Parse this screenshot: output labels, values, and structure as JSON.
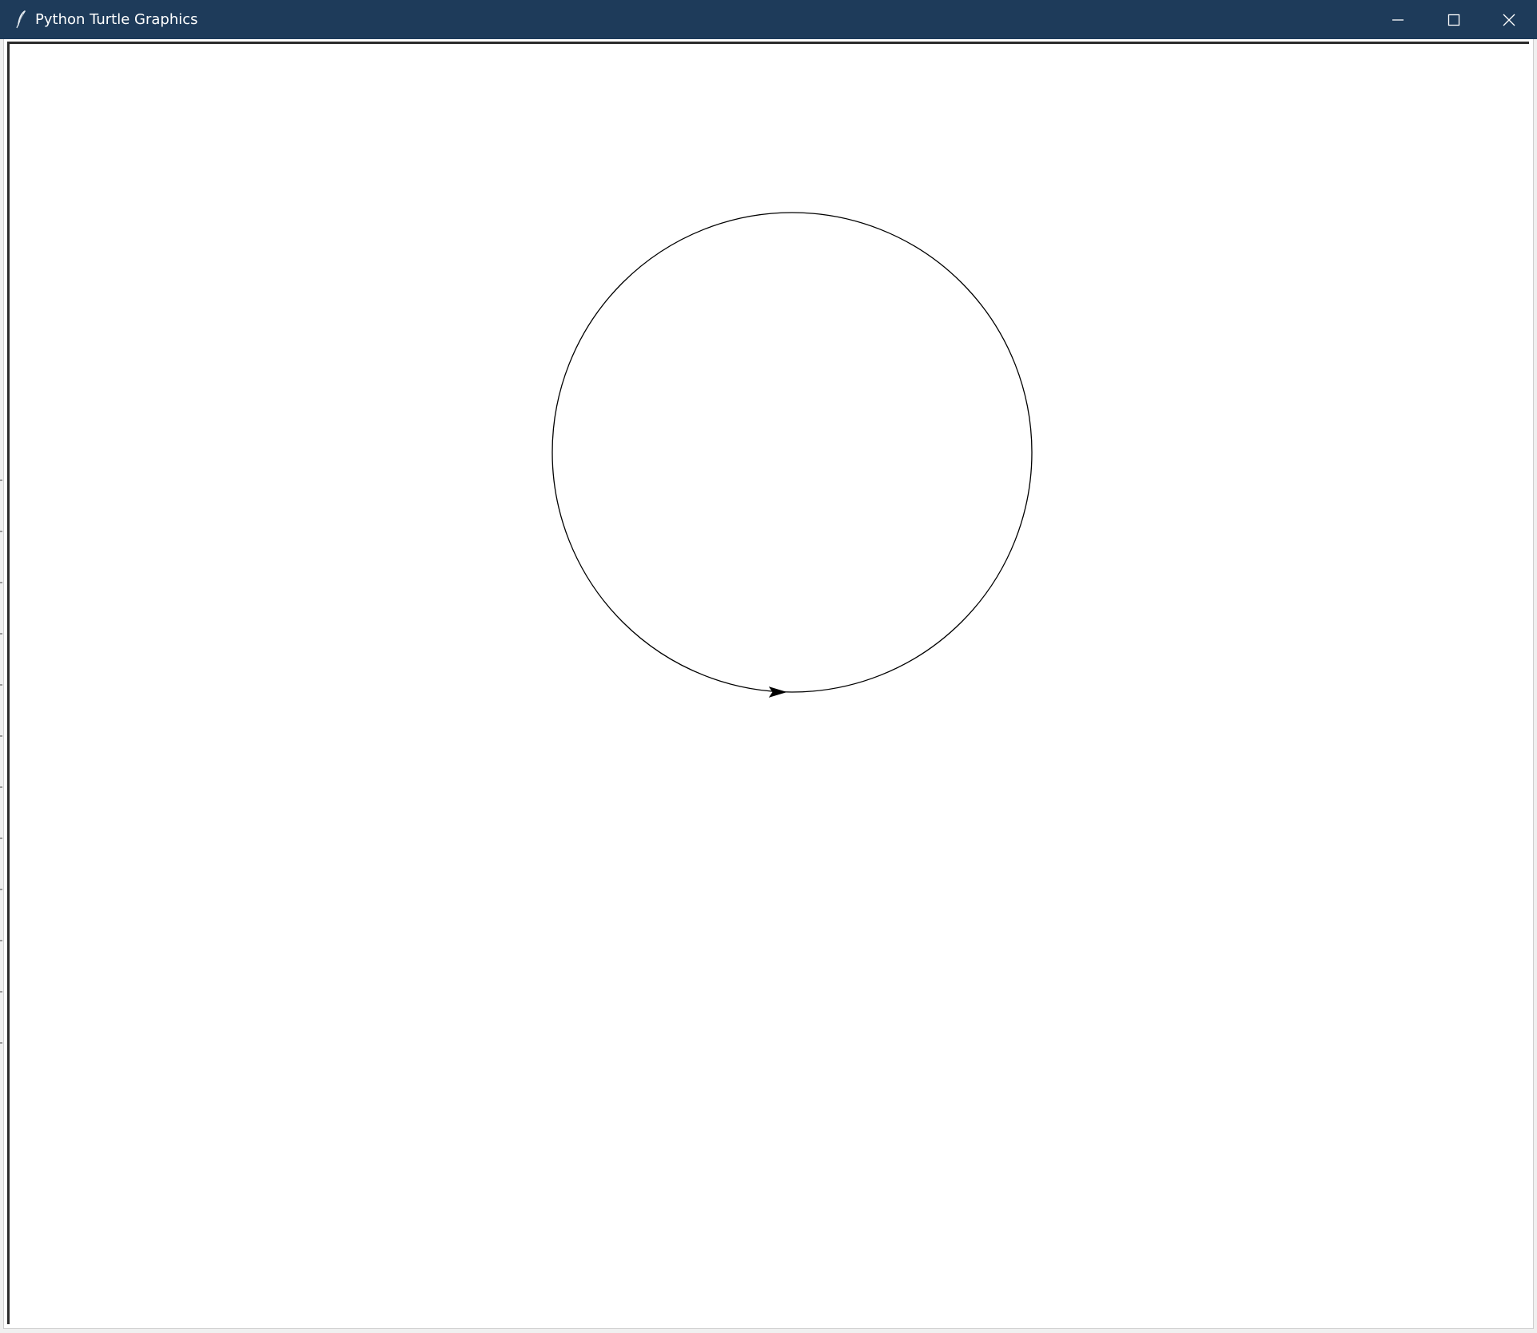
{
  "window": {
    "title": "Python Turtle Graphics",
    "title_bar_color": "#1e3b5a",
    "buttons": {
      "minimize": "minimize-icon",
      "maximize": "maximize-icon",
      "close": "close-icon"
    }
  },
  "canvas": {
    "background": "#ffffff",
    "pen_color": "#000000",
    "shape": "circle",
    "turtle_shape": "classic-arrow",
    "turtle_heading": "east"
  }
}
